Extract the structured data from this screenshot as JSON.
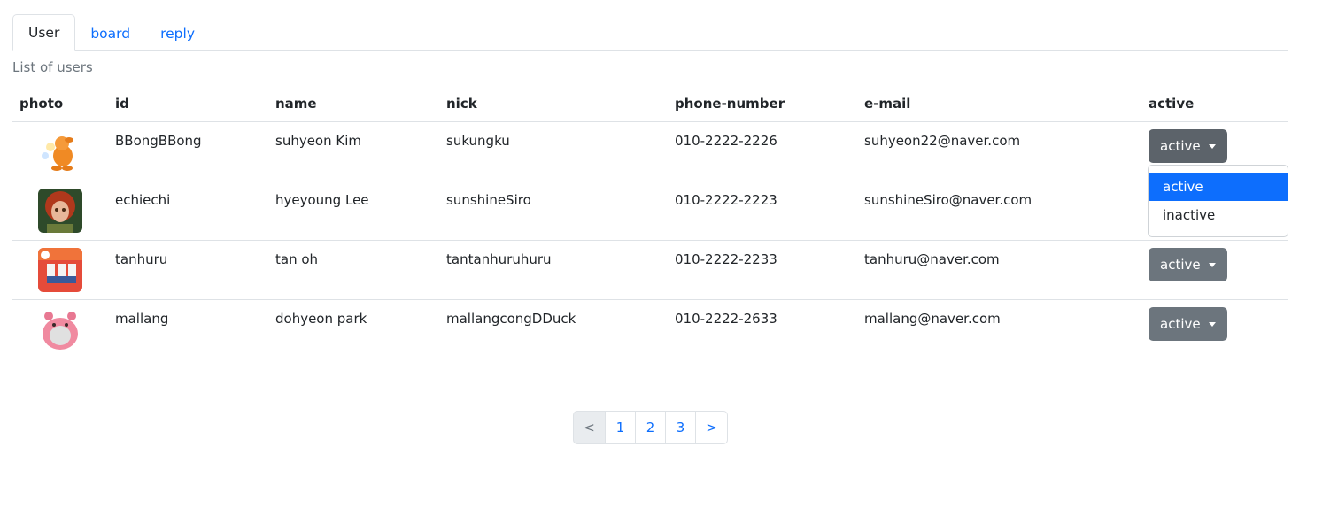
{
  "tabs": [
    {
      "label": "User",
      "active": true
    },
    {
      "label": "board",
      "active": false
    },
    {
      "label": "reply",
      "active": false
    }
  ],
  "caption": "List of users",
  "table": {
    "headers": [
      "photo",
      "id",
      "name",
      "nick",
      "phone-number",
      "e-mail",
      "active"
    ],
    "rows": [
      {
        "photo": "orange-character-avatar",
        "id": "BBongBBong",
        "name": "suhyeon Kim",
        "nick": "sukungku",
        "phone": "010-2222-2226",
        "email": "suhyeon22@naver.com",
        "active": "active"
      },
      {
        "photo": "red-haired-girl-avatar",
        "id": "echiechi",
        "name": "hyeyoung Lee",
        "nick": "sunshineSiro",
        "phone": "010-2222-2223",
        "email": "sunshineSiro@naver.com",
        "active": "active"
      },
      {
        "photo": "group-photo-avatar",
        "id": "tanhuru",
        "name": "tan oh",
        "nick": "tantanhuruhuru",
        "phone": "010-2222-2233",
        "email": "tanhuru@naver.com",
        "active": "active"
      },
      {
        "photo": "pink-character-avatar",
        "id": "mallang",
        "name": "dohyeon park",
        "nick": "mallangcongDDuck",
        "phone": "010-2222-2633",
        "email": "mallang@naver.com",
        "active": "active"
      }
    ]
  },
  "dropdown_menu": {
    "items": [
      "active",
      "inactive"
    ],
    "selected": "active"
  },
  "pagination": {
    "prev": "<",
    "pages": [
      "1",
      "2",
      "3"
    ],
    "next": ">"
  },
  "colors": {
    "link": "#0d6efd",
    "button": "#6c757d",
    "selected": "#0d6efd"
  }
}
